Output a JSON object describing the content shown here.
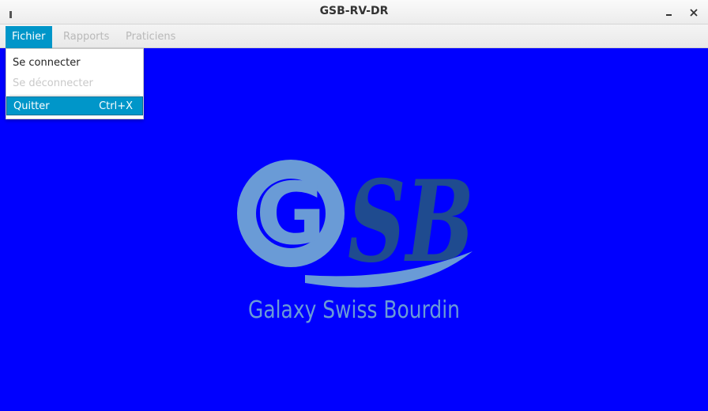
{
  "window": {
    "title": "GSB-RV-DR"
  },
  "menubar": {
    "items": [
      "Fichier",
      "Rapports",
      "Praticiens"
    ]
  },
  "fichier_menu": {
    "connect": "Se connecter",
    "disconnect": "Se déconnecter",
    "quit": "Quitter",
    "quit_shortcut": "Ctrl+X"
  },
  "logo": {
    "letters_g": "G",
    "letters_sb": "SB",
    "tagline": "Galaxy Swiss Bourdin"
  },
  "colors": {
    "background": "#0000ff",
    "accent": "#0096c9",
    "logo_light": "#6a9bd6",
    "logo_dark": "#1f4b8f"
  }
}
